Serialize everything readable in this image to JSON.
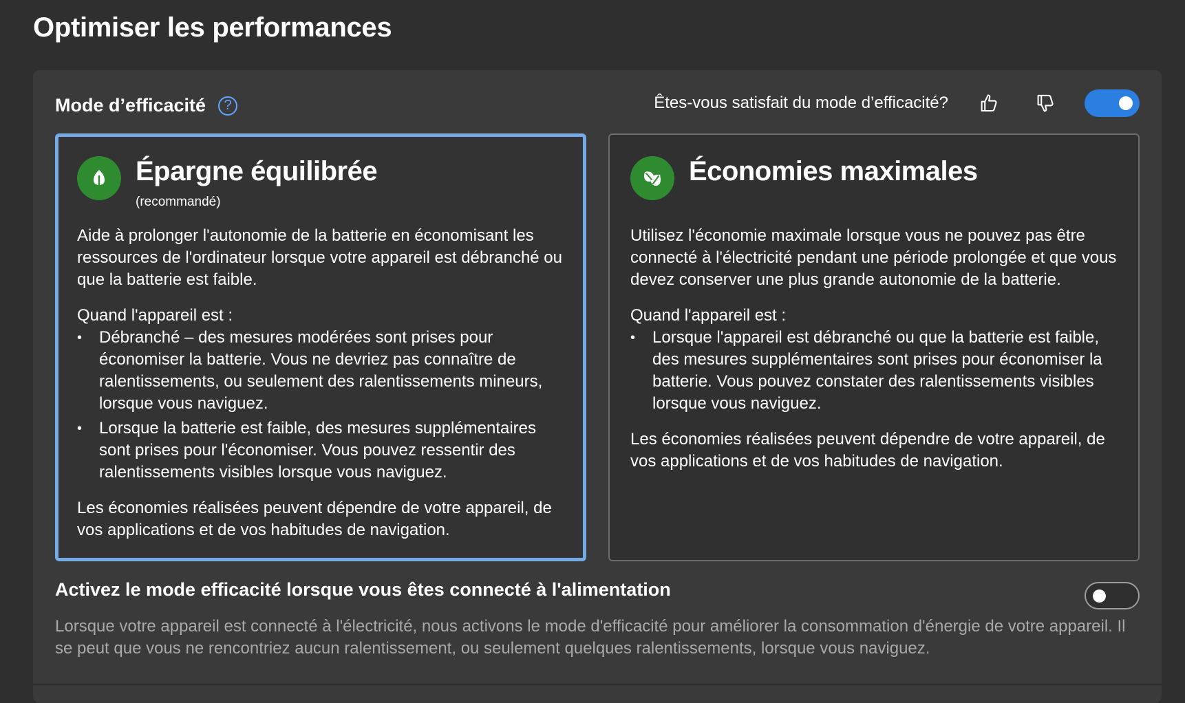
{
  "page": {
    "title": "Optimiser les performances"
  },
  "efficiency_mode": {
    "title": "Mode d’efficacité",
    "help_glyph": "?",
    "feedback_question": "Êtes-vous satisfait du mode d’efficacité?",
    "enabled": true,
    "accent_color": "#2b7fe0"
  },
  "cards": [
    {
      "title": "Épargne équilibrée",
      "subtitle": "(recommandé)",
      "selected": true,
      "icon": "leaf-icon",
      "description": "Aide à prolonger l'autonomie de la batterie en économisant les ressources de l'ordinateur lorsque votre appareil est débranché ou que la batterie est faible.",
      "when_label": "Quand l'appareil est :",
      "bullets": [
        "Débranché – des mesures modérées sont prises pour économiser la batterie. Vous ne devriez pas connaître de ralentissements, ou seulement des ralentissements mineurs, lorsque vous naviguez.",
        "Lorsque la batterie est faible, des mesures supplémentaires sont prises pour l'économiser. Vous pouvez ressentir des ralentissements visibles lorsque vous naviguez."
      ],
      "footer": "Les économies réalisées peuvent dépendre de votre appareil, de vos applications et de vos habitudes de navigation."
    },
    {
      "title": "Économies maximales",
      "subtitle": "",
      "selected": false,
      "icon": "leaves-icon",
      "description": "Utilisez l'économie maximale lorsque vous ne pouvez pas être connecté à l'électricité pendant une période prolongée et que vous devez conserver une plus grande autonomie de la batterie.",
      "when_label": "Quand l'appareil est :",
      "bullets": [
        "Lorsque l'appareil est débranché ou que la batterie est faible, des mesures supplémentaires sont prises pour économiser la batterie. Vous pouvez constater des ralentissements visibles lorsque vous naviguez."
      ],
      "footer": "Les économies réalisées peuvent dépendre de votre appareil, de vos applications et de vos habitudes de navigation."
    }
  ],
  "power_mode": {
    "title": "Activez le mode efficacité lorsque vous êtes connecté à l'alimentation",
    "description": "Lorsque votre appareil est connecté à l'électricité, nous activons le mode d'efficacité pour améliorer la consommation d'énergie de votre appareil. Il se peut que vous ne rencontriez aucun ralentissement, ou seulement quelques ralentissements, lorsque vous naviguez.",
    "enabled": false
  }
}
